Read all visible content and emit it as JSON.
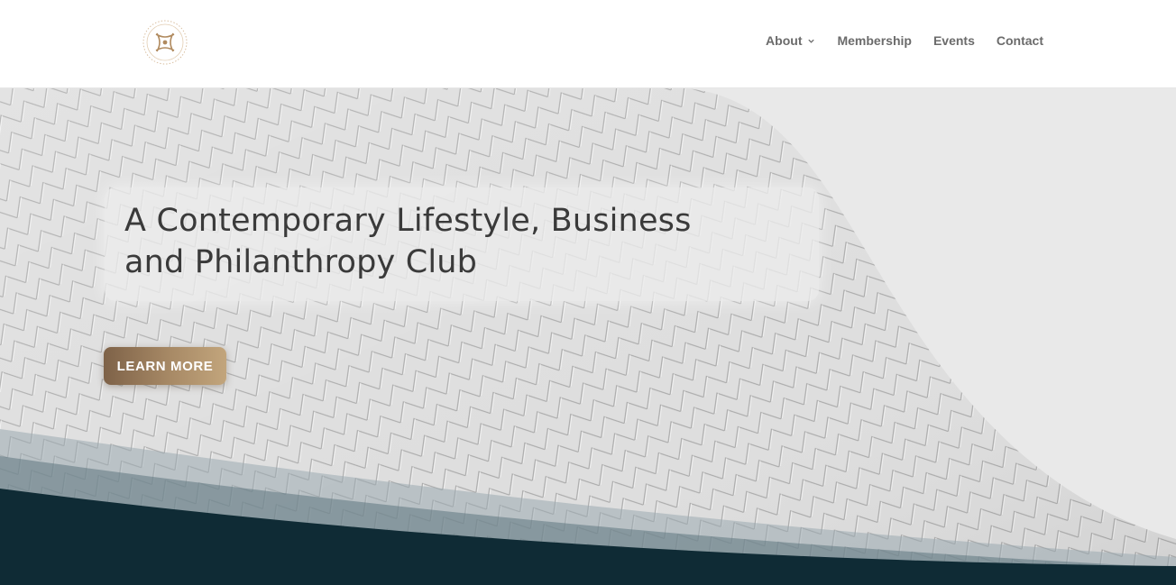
{
  "header": {
    "logo_icon": "club-emblem-icon",
    "nav": [
      {
        "label": "About",
        "has_dropdown": true
      },
      {
        "label": "Membership"
      },
      {
        "label": "Events"
      },
      {
        "label": "Contact"
      }
    ]
  },
  "hero": {
    "headline_line1": "A Contemporary Lifestyle, Business",
    "headline_line2": "and Philanthropy Club",
    "cta_label": "LEARN MORE"
  },
  "colors": {
    "accent_gold": "#a88a66",
    "nav_text": "#6b6b6b",
    "dark_band": "#0f2b35",
    "headline_text": "#3a3a3a"
  }
}
